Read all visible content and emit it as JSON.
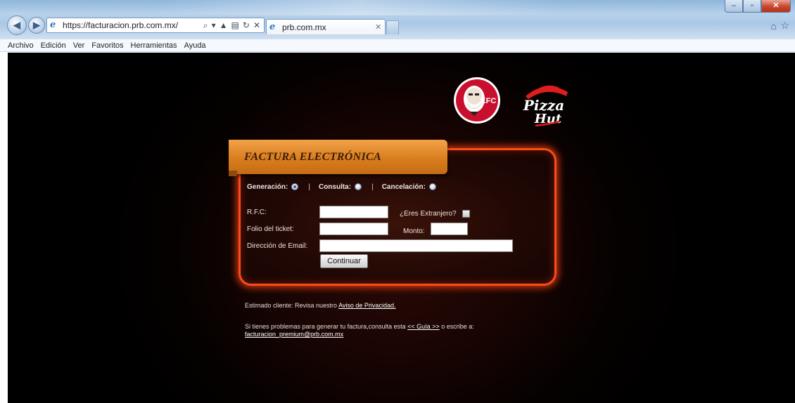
{
  "browser": {
    "url_prefix": "https://facturacion.",
    "url_domain": "prb.com.mx",
    "url_suffix": "/",
    "tab_title": "prb.com.mx",
    "menu": [
      "Archivo",
      "Edición",
      "Ver",
      "Favoritos",
      "Herramientas",
      "Ayuda"
    ]
  },
  "logos": {
    "kfc": "KFC",
    "pizza_hut_line1": "Pizza",
    "pizza_hut_line2": "Hut"
  },
  "form": {
    "title": "FACTURA ELECTRÓNICA",
    "modes": [
      {
        "label": "Generación:",
        "checked": true
      },
      {
        "label": "Consulta:",
        "checked": false
      },
      {
        "label": "Cancelación:",
        "checked": false
      }
    ],
    "separator": "|",
    "rfc_label": "R.F.C:",
    "rfc_value": "",
    "extranjero_label": "¿Eres Extranjero?",
    "folio_label": "Folio del ticket:",
    "folio_value": "",
    "monto_label": "Monto:",
    "monto_value": "",
    "email_label": "Dirección de Email:",
    "email_value": "",
    "submit_label": "Continuar"
  },
  "footer": {
    "privacy_text": "Estimado cliente: Revisa nuestro ",
    "privacy_link": "Aviso de Privacidad.",
    "help_text": "Si tienes problemas para generar tu factura,consulta esta ",
    "guide_link": "<< Guía >>",
    "help_text2": " o escribe a:",
    "email_link": "facturacion_premium@prb.com.mx"
  },
  "colors": {
    "panel_glow": "#ff4a1a",
    "title_bar": "#d97e1e",
    "background": "#000000"
  }
}
